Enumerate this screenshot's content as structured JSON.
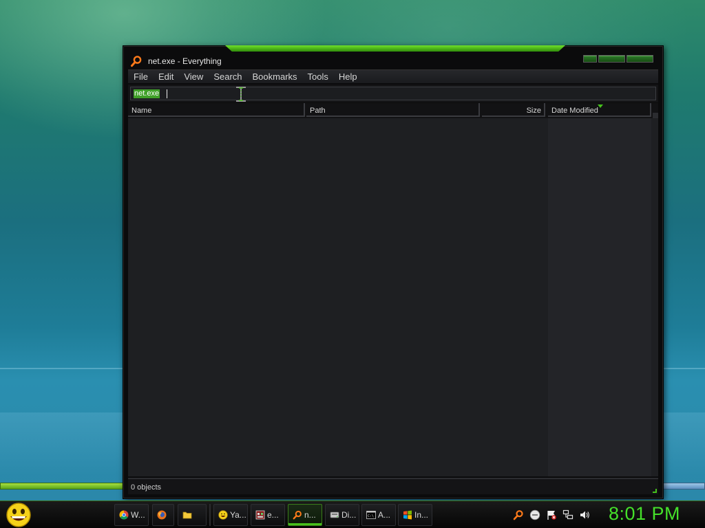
{
  "window": {
    "title": "net.exe - Everything",
    "app_icon": "magnifier-icon"
  },
  "menu": [
    "File",
    "Edit",
    "View",
    "Search",
    "Bookmarks",
    "Tools",
    "Help"
  ],
  "search": {
    "value": "net.exe"
  },
  "columns": {
    "name": "Name",
    "path": "Path",
    "size": "Size",
    "date_modified": "Date Modified",
    "sorted_by": "Date Modified"
  },
  "results": [],
  "status": {
    "text": "0 objects"
  },
  "taskbar": {
    "start_icon": "smiley-orb-icon",
    "tasks": [
      {
        "label": "W...",
        "icon": "chrome-icon"
      },
      {
        "label": "",
        "icon": "firefox-icon"
      },
      {
        "label": "",
        "icon": "folder-icon"
      },
      {
        "label": "Ya...",
        "icon": "yahoo-messenger-icon"
      },
      {
        "label": "e...",
        "icon": "app-window-icon"
      },
      {
        "label": "n...",
        "icon": "everything-search-icon",
        "active": true
      },
      {
        "label": "Di...",
        "icon": "disk-icon"
      },
      {
        "label": "A...",
        "icon": "command-prompt-icon"
      },
      {
        "label": "In...",
        "icon": "windows-flag-icon"
      }
    ],
    "tray": [
      "everything-search-icon",
      "messenger-icon",
      "action-center-flag-icon",
      "network-icon",
      "volume-icon"
    ],
    "clock": "8:01 PM"
  },
  "colors": {
    "accent_green": "#46c21c",
    "window_bg": "#0b0b0c",
    "list_bg": "#1e1f22",
    "clock_green": "#45e02a"
  }
}
